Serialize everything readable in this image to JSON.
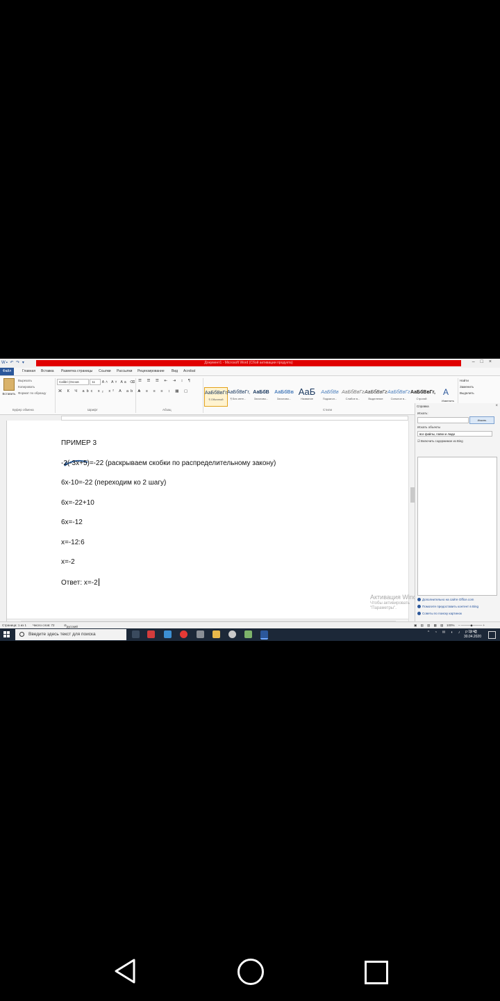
{
  "window": {
    "title": "Документ1 - Microsoft Word (Сбой активации продукта)",
    "controls": [
      "–",
      "□",
      "×"
    ]
  },
  "ribbon": {
    "tabs": [
      "Файл",
      "Главная",
      "Вставка",
      "Разметка страницы",
      "Ссылки",
      "Рассылки",
      "Рецензирование",
      "Вид",
      "Acrobat"
    ],
    "clipboard": {
      "paste": "Вставить",
      "cut": "Вырезать",
      "copy": "Копировать",
      "format_painter": "Формат по образцу",
      "group_label": "Буфер обмена"
    },
    "font": {
      "name": "Calibri (Основ",
      "size": "11",
      "group_label": "Шрифт"
    },
    "paragraph": {
      "group_label": "Абзац"
    },
    "styles": {
      "items": [
        {
          "sample": "АаБбВвГг,",
          "name": "¶ Обычный"
        },
        {
          "sample": "АаБбВвГг,",
          "name": "¶ Без инте..."
        },
        {
          "sample": "АаБбВ",
          "name": "Заголово..."
        },
        {
          "sample": "АаБбВв",
          "name": "Заголово..."
        },
        {
          "sample": "АаБ",
          "name": "Название"
        },
        {
          "sample": "АаБбВв",
          "name": "Подзагол..."
        },
        {
          "sample": "АаБбВвГг",
          "name": "Слабое в..."
        },
        {
          "sample": "АаБбВвГг",
          "name": "Выделение"
        },
        {
          "sample": "АаБбВвГг",
          "name": "Сильное в..."
        },
        {
          "sample": "АаБбВвГг,",
          "name": "Строгий"
        }
      ],
      "change_styles": "Изменить стили",
      "group_label": "Стили"
    },
    "editing": {
      "find": "Найти",
      "replace": "Заменить",
      "select": "Выделить",
      "group_label": "Редактирование"
    }
  },
  "document": {
    "lines": [
      "ПРИМЕР 3",
      "-2(-3x+5)=-22 (раскрываем скобки по распределительному закону)",
      "6x-10=-22 (переходим ко 2 шагу)",
      "6x=-22+10",
      "6x=-12",
      "x=-12:6",
      "x=-2",
      "Ответ: x=-2"
    ]
  },
  "watermark": {
    "line1": "Активация Windows",
    "line2": "Чтобы активировать",
    "line3": "\"Параметры\"."
  },
  "nav_pane": {
    "title": "Справка",
    "search_label": "Искать:",
    "search_button": "Искать",
    "scope_label": "Искать объекты",
    "scope_value": "все файлы, папки и люди",
    "checkbox": "Включить содержимое из Bing",
    "links": [
      "Дополнительно на сайте Office.com",
      "Помогите предоставить контент в Bing",
      "Советы по поиску картинок"
    ]
  },
  "statusbar": {
    "page": "Страница: 1 из 1",
    "words": "Число слов: 72",
    "language": "русский",
    "zoom": "100%"
  },
  "taskbar": {
    "search_placeholder": "Введите здесь текст для поиска",
    "lang": "РУС",
    "time": "11:43",
    "date": "30.04.2020"
  },
  "colors": {
    "word_blue": "#2b579a",
    "activation_red": "#e00000",
    "taskbar": "#1c2838"
  }
}
